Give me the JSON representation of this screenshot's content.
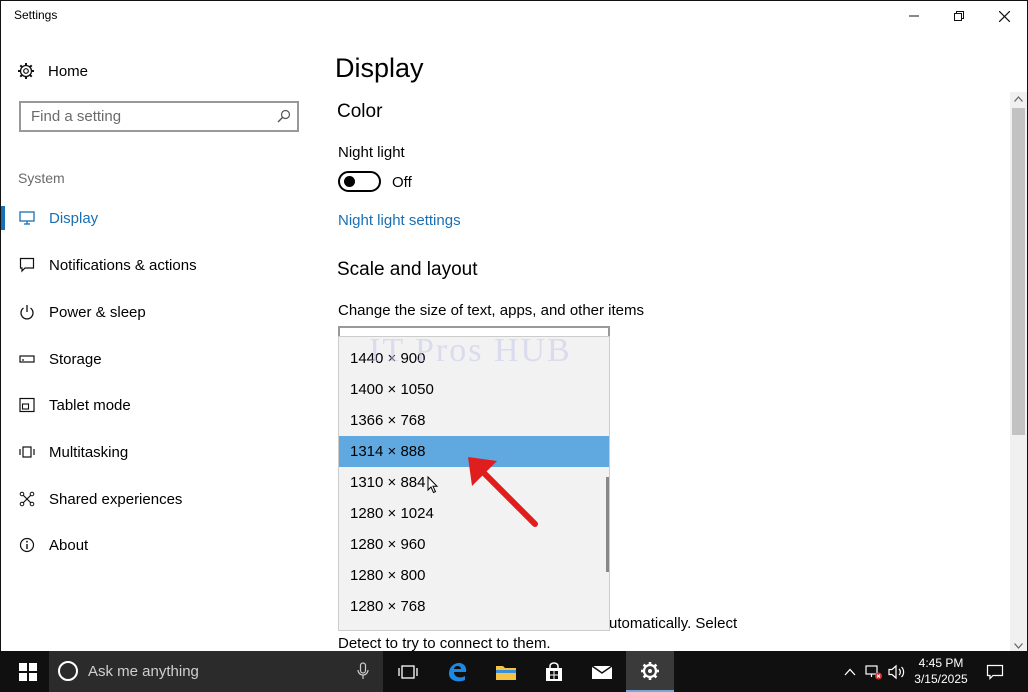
{
  "window": {
    "title": "Settings"
  },
  "sidebar": {
    "home_label": "Home",
    "search_placeholder": "Find a setting",
    "group_heading": "System",
    "items": [
      {
        "label": "Display",
        "icon": "monitor-icon",
        "selected": true
      },
      {
        "label": "Notifications & actions",
        "icon": "message-icon",
        "selected": false
      },
      {
        "label": "Power & sleep",
        "icon": "power-icon",
        "selected": false
      },
      {
        "label": "Storage",
        "icon": "storage-icon",
        "selected": false
      },
      {
        "label": "Tablet mode",
        "icon": "tablet-icon",
        "selected": false
      },
      {
        "label": "Multitasking",
        "icon": "multitasking-icon",
        "selected": false
      },
      {
        "label": "Shared experiences",
        "icon": "shared-experiences-icon",
        "selected": false
      },
      {
        "label": "About",
        "icon": "info-icon",
        "selected": false
      }
    ]
  },
  "main": {
    "page_title": "Display",
    "color_heading": "Color",
    "night_light_label": "Night light",
    "night_light_state": "Off",
    "night_light_link": "Night light settings",
    "scale_heading": "Scale and layout",
    "scale_description": "Change the size of text, apps, and other items",
    "partial_line_1": "utomatically. Select",
    "partial_line_2": "Detect to try to connect to them."
  },
  "resolution_dropdown": {
    "options": [
      "1440 × 900",
      "1400 × 1050",
      "1366 × 768",
      "1314 × 888",
      "1310 × 884",
      "1280 × 1024",
      "1280 × 960",
      "1280 × 800",
      "1280 × 768"
    ],
    "selected": "1314 × 888"
  },
  "watermark": "IT Pros HUB",
  "taskbar": {
    "search_text": "Ask me anything",
    "time": "4:45 PM",
    "date": "3/15/2025"
  },
  "colors": {
    "accent": "#1a6fb3",
    "selected_option": "#5fa8e0",
    "taskbar": "#101010",
    "annotation_arrow": "#e01e1e"
  }
}
